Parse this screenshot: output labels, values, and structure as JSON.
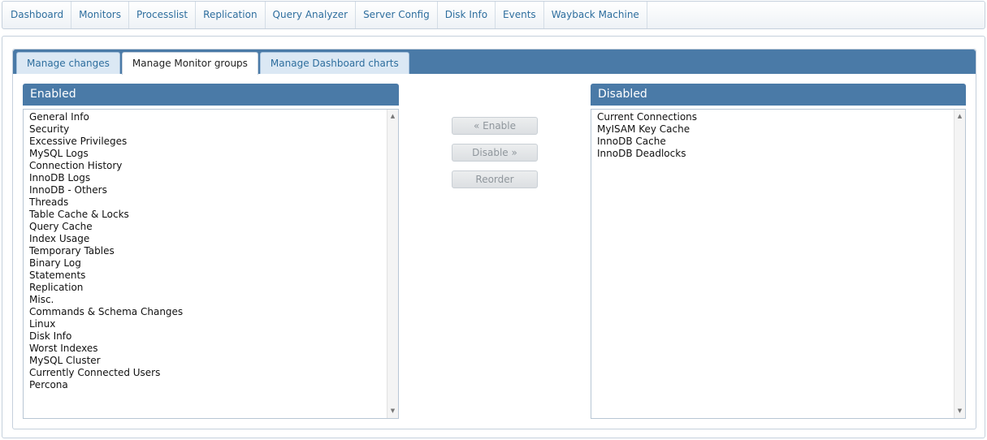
{
  "nav": {
    "items": [
      "Dashboard",
      "Monitors",
      "Processlist",
      "Replication",
      "Query Analyzer",
      "Server Config",
      "Disk Info",
      "Events",
      "Wayback Machine"
    ]
  },
  "tabs": {
    "items": [
      "Manage changes",
      "Manage Monitor groups",
      "Manage Dashboard charts"
    ],
    "active": "Manage Monitor groups"
  },
  "enabled": {
    "title": "Enabled",
    "items": [
      "General Info",
      "Security",
      "Excessive Privileges",
      "MySQL Logs",
      "Connection History",
      "InnoDB Logs",
      "InnoDB - Others",
      "Threads",
      "Table Cache & Locks",
      "Query Cache",
      "Index Usage",
      "Temporary Tables",
      "Binary Log",
      "Statements",
      "Replication",
      "Misc.",
      "Commands & Schema Changes",
      "Linux",
      "Disk Info",
      "Worst Indexes",
      "MySQL Cluster",
      "Currently Connected Users",
      "Percona"
    ]
  },
  "disabled": {
    "title": "Disabled",
    "items": [
      "Current Connections",
      "MyISAM Key Cache",
      "InnoDB Cache",
      "InnoDB Deadlocks"
    ]
  },
  "buttons": {
    "enable": "« Enable",
    "disable": "Disable »",
    "reorder": "Reorder"
  },
  "icons": {
    "scroll_up": "up-arrow-icon",
    "scroll_down": "down-arrow-icon"
  },
  "colors": {
    "header_blue": "#4a7aa7",
    "link_blue": "#2e6e9e"
  }
}
